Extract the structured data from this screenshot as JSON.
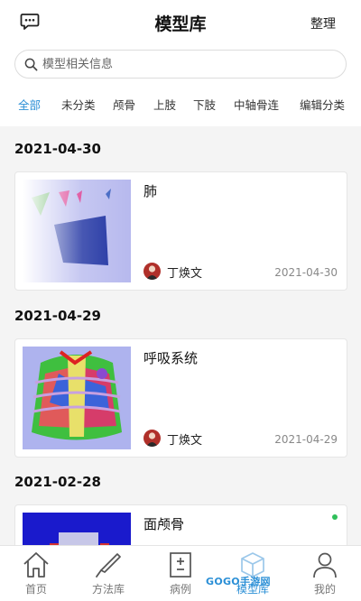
{
  "header": {
    "title": "模型库",
    "action_label": "整理",
    "chat_icon": "chat-bubble-icon"
  },
  "search": {
    "placeholder": "模型相关信息",
    "icon": "search-icon"
  },
  "tabs": [
    {
      "label": "全部",
      "active": true
    },
    {
      "label": "未分类"
    },
    {
      "label": "颅骨"
    },
    {
      "label": "上肢"
    },
    {
      "label": "下肢"
    },
    {
      "label": "中轴骨连"
    },
    {
      "label": "编辑分类"
    }
  ],
  "groups": [
    {
      "date": "2021-04-30",
      "card": {
        "title": "肺",
        "author": "丁焕文",
        "date": "2021-04-30"
      }
    },
    {
      "date": "2021-04-29",
      "card": {
        "title": "呼吸系统",
        "author": "丁焕文",
        "date": "2021-04-29"
      }
    },
    {
      "date": "2021-02-28",
      "card": {
        "title": "面颅骨",
        "status_dot": true
      }
    }
  ],
  "bottom_nav": [
    {
      "label": "首页",
      "icon": "home-icon"
    },
    {
      "label": "方法库",
      "icon": "scalpel-icon"
    },
    {
      "label": "病例",
      "icon": "case-icon"
    },
    {
      "label": "模型库",
      "icon": "cube-icon",
      "active": true
    },
    {
      "label": "我的",
      "icon": "user-icon"
    }
  ],
  "watermark": "GOGO手游网",
  "colors": {
    "accent": "#2b8fd6",
    "status_green": "#2fbf5a"
  }
}
